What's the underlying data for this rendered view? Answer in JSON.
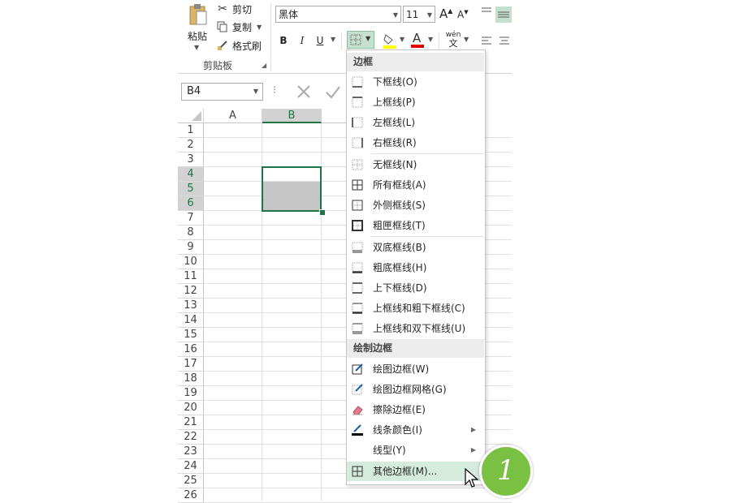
{
  "clipboard": {
    "paste_label": "粘贴",
    "cut_label": "剪切",
    "copy_label": "复制",
    "format_painter_label": "格式刷",
    "group_label": "剪贴板"
  },
  "font": {
    "font_name": "黑体",
    "font_size": "11",
    "bold": "B",
    "italic": "I",
    "underline": "U",
    "font_color_glyph": "A",
    "phonetic_glyph": "wén"
  },
  "formula_bar": {
    "name_box": "B4"
  },
  "grid": {
    "columns": [
      "A",
      "B"
    ],
    "selected_column": "B",
    "rows": [
      "1",
      "2",
      "3",
      "4",
      "5",
      "6",
      "7",
      "8",
      "9",
      "10",
      "11",
      "12",
      "13",
      "14",
      "15",
      "16",
      "17",
      "18",
      "19",
      "20",
      "21",
      "22",
      "23",
      "24",
      "25",
      "26"
    ],
    "selected_rows": [
      "4",
      "5",
      "6"
    ]
  },
  "menu": {
    "header_borders": "边框",
    "items_group1": [
      {
        "label": "下框线(O)",
        "icon": "bottom-border-icon"
      },
      {
        "label": "上框线(P)",
        "icon": "top-border-icon"
      },
      {
        "label": "左框线(L)",
        "icon": "left-border-icon"
      },
      {
        "label": "右框线(R)",
        "icon": "right-border-icon"
      }
    ],
    "items_group2": [
      {
        "label": "无框线(N)",
        "icon": "no-border-icon"
      },
      {
        "label": "所有框线(A)",
        "icon": "all-borders-icon"
      },
      {
        "label": "外侧框线(S)",
        "icon": "outside-borders-icon"
      },
      {
        "label": "粗匣框线(T)",
        "icon": "thick-box-border-icon"
      }
    ],
    "items_group3": [
      {
        "label": "双底框线(B)",
        "icon": "double-bottom-border-icon"
      },
      {
        "label": "粗底框线(H)",
        "icon": "thick-bottom-border-icon"
      },
      {
        "label": "上下框线(D)",
        "icon": "top-bottom-border-icon"
      },
      {
        "label": "上框线和粗下框线(C)",
        "icon": "top-thick-bottom-border-icon"
      },
      {
        "label": "上框线和双下框线(U)",
        "icon": "top-double-bottom-border-icon"
      }
    ],
    "header_draw": "绘制边框",
    "items_draw": [
      {
        "label": "绘图边框(W)",
        "icon": "draw-border-icon"
      },
      {
        "label": "绘图边框网格(G)",
        "icon": "draw-border-grid-icon"
      },
      {
        "label": "擦除边框(E)",
        "icon": "eraser-icon"
      },
      {
        "label": "线条颜色(I)",
        "icon": "line-color-icon"
      },
      {
        "label": "线型(Y)",
        "icon": ""
      },
      {
        "label": "其他边框(M)...",
        "icon": "more-borders-icon"
      }
    ]
  },
  "annotation": {
    "step_number": "1"
  },
  "colors": {
    "accent_green": "#217346",
    "hover_green": "#d5ebdd",
    "badge_green": "#7ac143"
  }
}
